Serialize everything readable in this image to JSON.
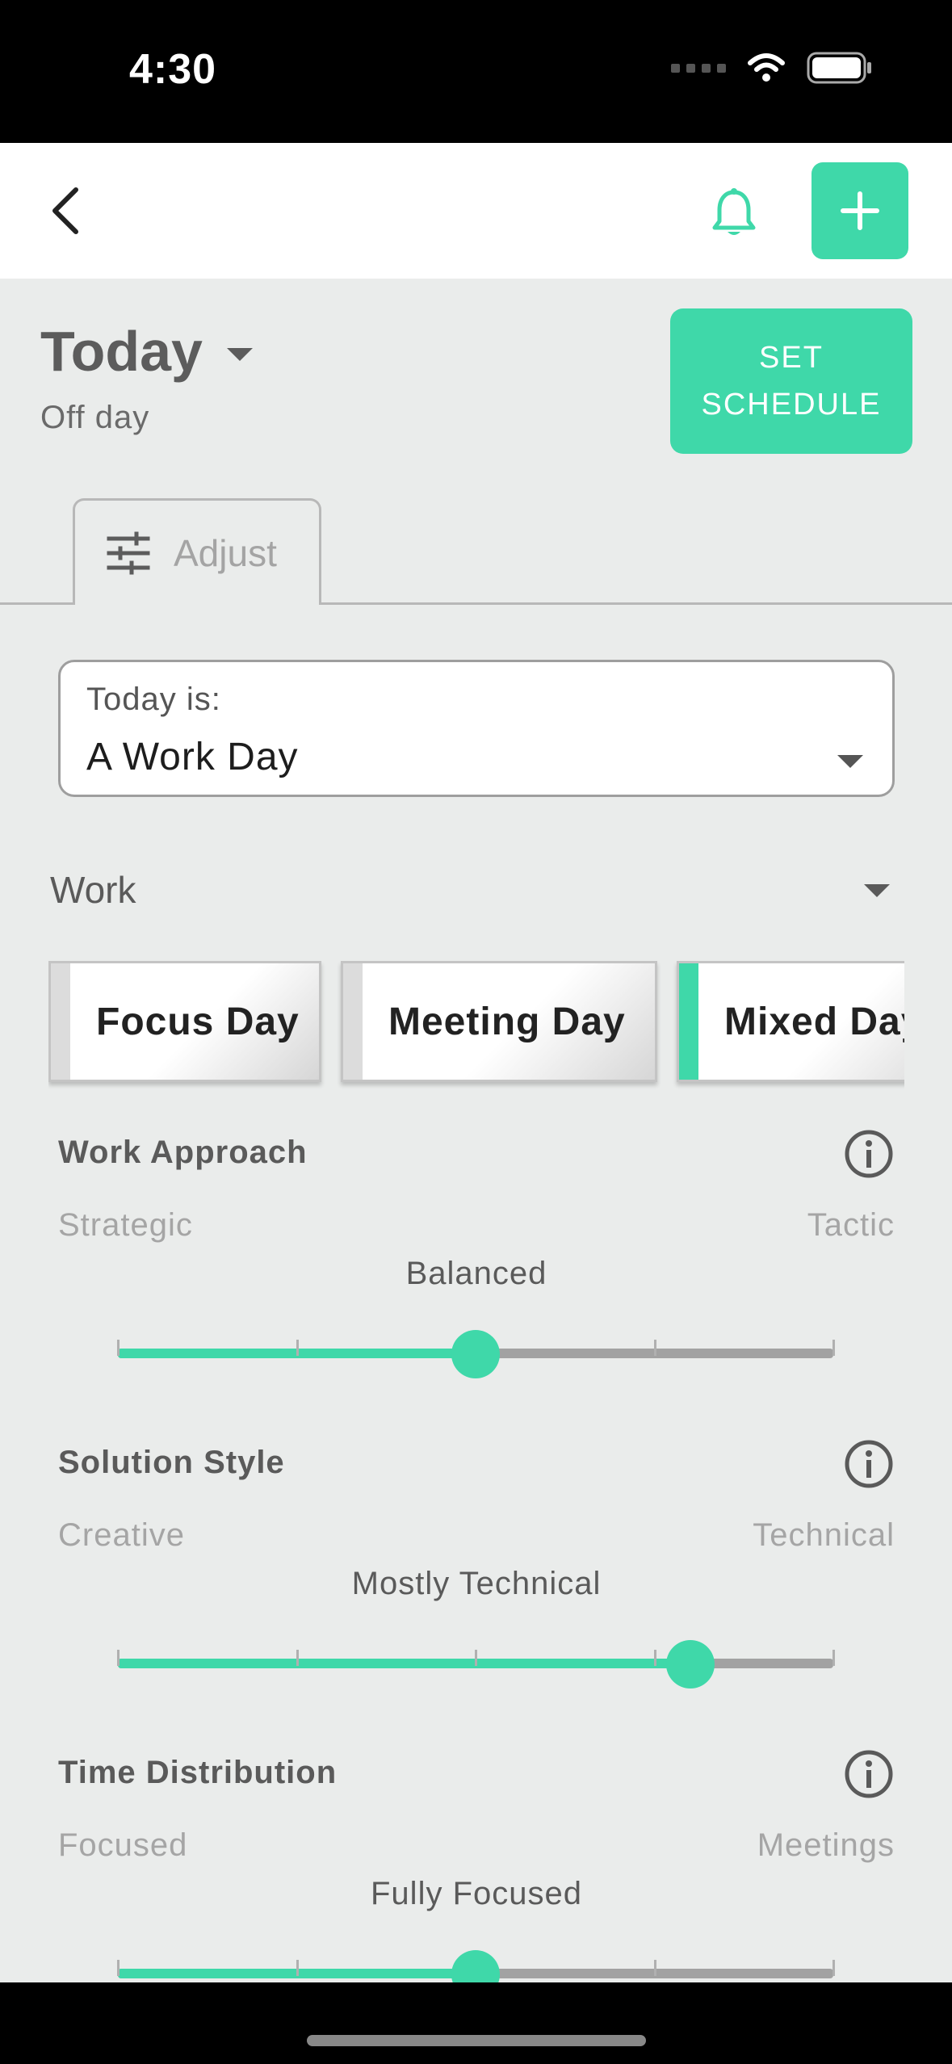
{
  "status": {
    "time": "4:30"
  },
  "header": {
    "title": "Today",
    "subtitle": "Off day",
    "set_schedule_label": "SET SCHEDULE"
  },
  "tabs": [
    {
      "label": "Adjust"
    }
  ],
  "day_type": {
    "label": "Today is:",
    "value": "A Work Day"
  },
  "category": {
    "label": "Work"
  },
  "presets": [
    {
      "label": "Focus Day",
      "selected": false
    },
    {
      "label": "Meeting Day",
      "selected": false
    },
    {
      "label": "Mixed Day",
      "selected": true
    }
  ],
  "params": [
    {
      "title": "Work Approach",
      "left": "Strategic",
      "right": "Tactic",
      "current": "Balanced",
      "value_fraction": 0.5
    },
    {
      "title": "Solution Style",
      "left": "Creative",
      "right": "Technical",
      "current": "Mostly Technical",
      "value_fraction": 0.8
    },
    {
      "title": "Time Distribution",
      "left": "Focused",
      "right": "Meetings",
      "current": "Fully Focused",
      "value_fraction": 0.5
    }
  ],
  "colors": {
    "accent": "#3fd8a9",
    "background": "#eaeceb",
    "text": "#5a5a5a"
  },
  "icons": [
    "back-arrow-icon",
    "bell-icon",
    "plus-icon",
    "sliders-icon",
    "info-icon",
    "wifi-icon",
    "battery-icon"
  ]
}
